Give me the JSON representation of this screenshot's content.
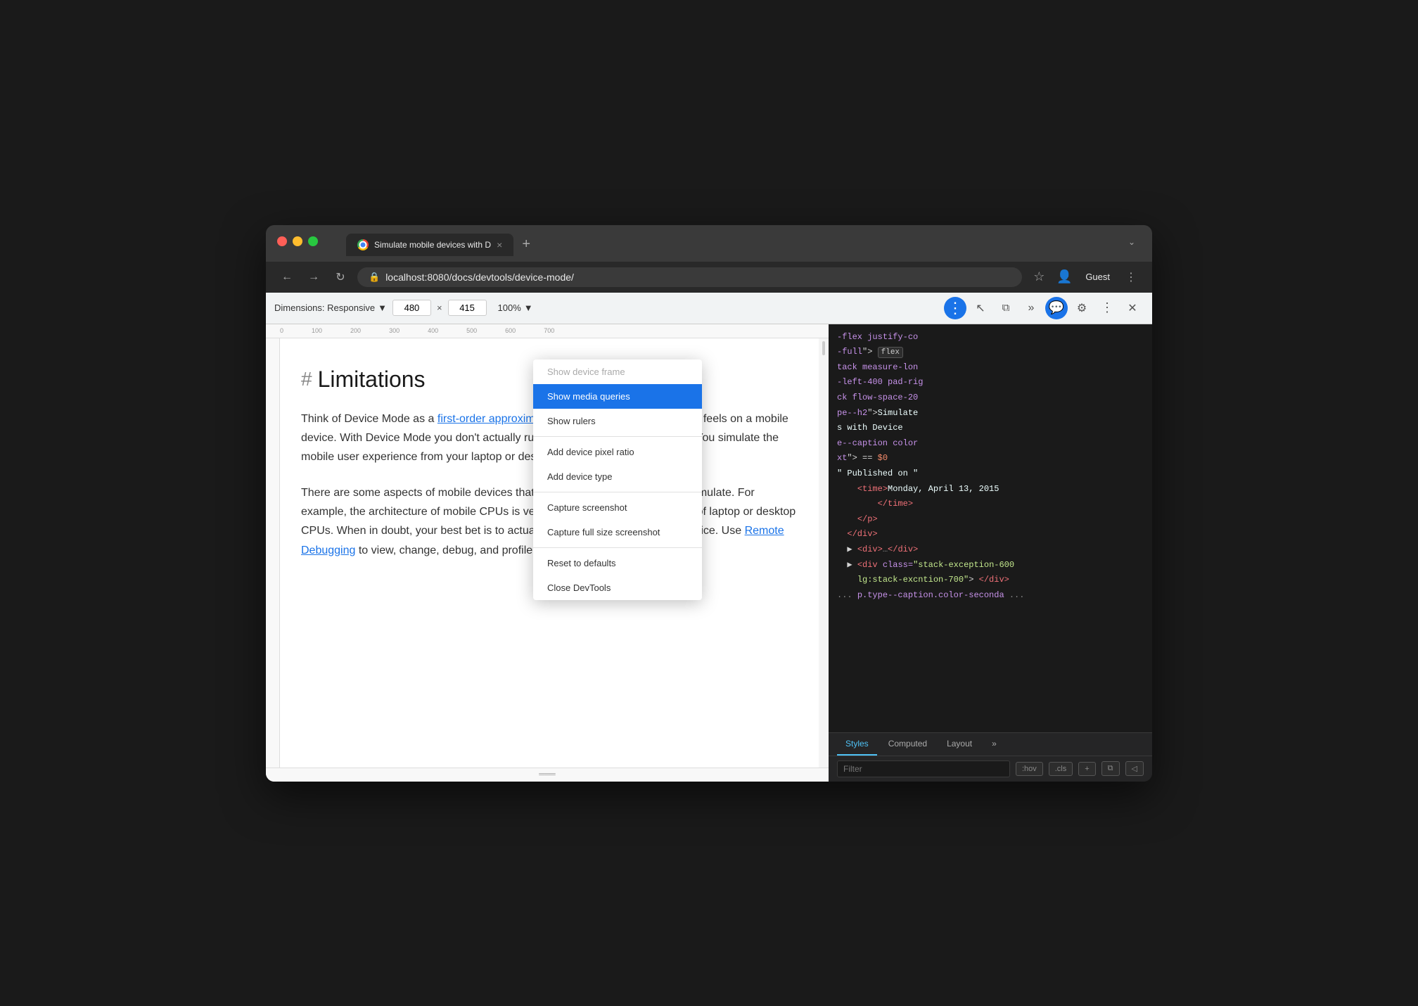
{
  "browser": {
    "traffic_lights": [
      "close",
      "minimize",
      "maximize"
    ],
    "tab": {
      "title": "Simulate mobile devices with D",
      "url": "localhost:8080/docs/devtools/device-mode/",
      "close_label": "×"
    },
    "new_tab_label": "+",
    "tab_menu_label": "⌄",
    "nav": {
      "back": "←",
      "forward": "→",
      "reload": "↻",
      "lock_icon": "🔒"
    },
    "guest_label": "Guest",
    "profile_icon": "person",
    "more_icon": "⋮"
  },
  "devtools_bar": {
    "dimensions_label": "Dimensions: Responsive",
    "width_value": "480",
    "height_value": "415",
    "separator": "×",
    "zoom_label": "100%",
    "zoom_arrow": "▼",
    "dimensions_arrow": "▼"
  },
  "page": {
    "heading": "Limitations",
    "hash": "#",
    "paragraphs": [
      "Think of Device Mode as a first-order approximation of how your page looks and feels on a mobile device. With Device Mode you don't actually run your code on a mobile device. You simulate the mobile user experience from your laptop or desktop.",
      "There are some aspects of mobile devices that DevTools will never be able to simulate. For example, the architecture of mobile CPUs is very different than the architecture of laptop or desktop CPUs. When in doubt, your best bet is to actually run your page on a mobile device. Use Remote Debugging to view, change, debug, and profile a page's"
    ],
    "links": [
      {
        "text": "first-order approximation",
        "href": "#"
      },
      {
        "text": "Remote Debugging",
        "href": "#"
      }
    ]
  },
  "devtools_panel": {
    "code_lines": [
      "-flex justify-co",
      "-full\"> flex",
      "tack measure-lon",
      "-left-400 pad-rig",
      "ck flow-space-20",
      "pe--h2\">Simulate",
      "s with Device",
      "e--caption color",
      "xt\"> == $0",
      "\" Published on \"",
      "<time>Monday, April 13, 2015",
      "</time>",
      "</p>",
      "</div>",
      "<div>…</div>",
      "<div class=\"stack-exception-600",
      "lg:stack-excntion-700\"> </div>",
      "... p.type--caption.color-seconda ..."
    ]
  },
  "dropdown_menu": {
    "items": [
      {
        "label": "Show device frame",
        "highlighted": false,
        "disabled": true
      },
      {
        "label": "Show media queries",
        "highlighted": true,
        "disabled": false
      },
      {
        "label": "Show rulers",
        "highlighted": false,
        "disabled": false
      },
      {
        "divider": true
      },
      {
        "label": "Add device pixel ratio",
        "highlighted": false,
        "disabled": false
      },
      {
        "label": "Add device type",
        "highlighted": false,
        "disabled": false
      },
      {
        "divider": true
      },
      {
        "label": "Capture screenshot",
        "highlighted": false,
        "disabled": false
      },
      {
        "label": "Capture full size screenshot",
        "highlighted": false,
        "disabled": false
      },
      {
        "divider": true
      },
      {
        "label": "Reset to defaults",
        "highlighted": false,
        "disabled": false
      },
      {
        "label": "Close DevTools",
        "highlighted": false,
        "disabled": false
      }
    ]
  },
  "bottom_panel": {
    "tabs": [
      "Styles",
      "Computed",
      "Layout"
    ],
    "active_tab": "Styles",
    "filter_placeholder": "Filter",
    "filter_buttons": [
      ":hov",
      ".cls",
      "+"
    ]
  }
}
